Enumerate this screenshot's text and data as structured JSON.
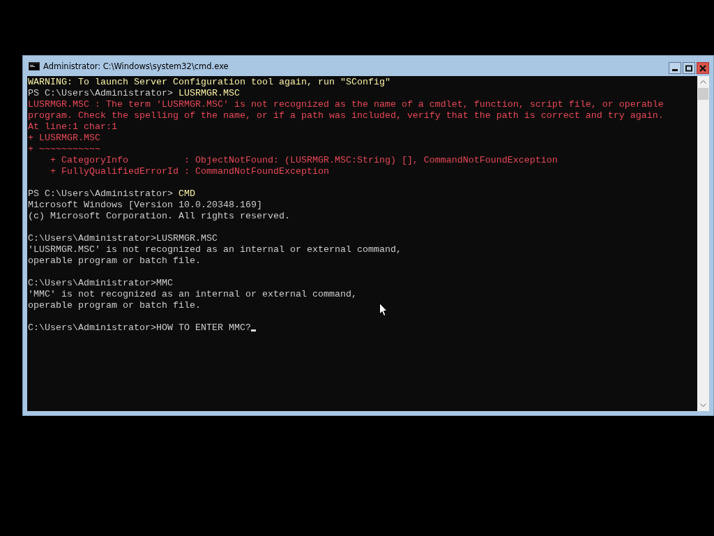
{
  "window": {
    "title": "Administrator: C:\\Windows\\system32\\cmd.exe"
  },
  "console": {
    "lines": [
      {
        "kind": "warning",
        "text": "WARNING: To launch Server Configuration tool again, run \"SConfig\""
      },
      {
        "kind": "ps_prompt",
        "prompt": "PS C:\\Users\\Administrator> ",
        "command": "LUSRMGR.MSC"
      },
      {
        "kind": "error",
        "text": "LUSRMGR.MSC : The term 'LUSRMGR.MSC' is not recognized as the name of a cmdlet, function, script file, or operable"
      },
      {
        "kind": "error",
        "text": "program. Check the spelling of the name, or if a path was included, verify that the path is correct and try again."
      },
      {
        "kind": "error",
        "text": "At line:1 char:1"
      },
      {
        "kind": "error",
        "text": "+ LUSRMGR.MSC"
      },
      {
        "kind": "error",
        "text": "+ ~~~~~~~~~~~"
      },
      {
        "kind": "error",
        "text": "    + CategoryInfo          : ObjectNotFound: (LUSRMGR.MSC:String) [], CommandNotFoundException"
      },
      {
        "kind": "error",
        "text": "    + FullyQualifiedErrorId : CommandNotFoundException"
      },
      {
        "kind": "blank"
      },
      {
        "kind": "ps_prompt",
        "prompt": "PS C:\\Users\\Administrator> ",
        "command": "CMD"
      },
      {
        "kind": "output",
        "text": "Microsoft Windows [Version 10.0.20348.169]"
      },
      {
        "kind": "output",
        "text": "(c) Microsoft Corporation. All rights reserved."
      },
      {
        "kind": "blank"
      },
      {
        "kind": "cmd_prompt",
        "prompt": "C:\\Users\\Administrator>",
        "command": "LUSRMGR.MSC"
      },
      {
        "kind": "output",
        "text": "'LUSRMGR.MSC' is not recognized as an internal or external command,"
      },
      {
        "kind": "output",
        "text": "operable program or batch file."
      },
      {
        "kind": "blank"
      },
      {
        "kind": "cmd_prompt",
        "prompt": "C:\\Users\\Administrator>",
        "command": "MMC"
      },
      {
        "kind": "output",
        "text": "'MMC' is not recognized as an internal or external command,"
      },
      {
        "kind": "output",
        "text": "operable program or batch file."
      },
      {
        "kind": "blank"
      },
      {
        "kind": "cmd_prompt",
        "prompt": "C:\\Users\\Administrator>",
        "command": "HOW TO ENTER MMC?",
        "cursor": true
      }
    ]
  }
}
